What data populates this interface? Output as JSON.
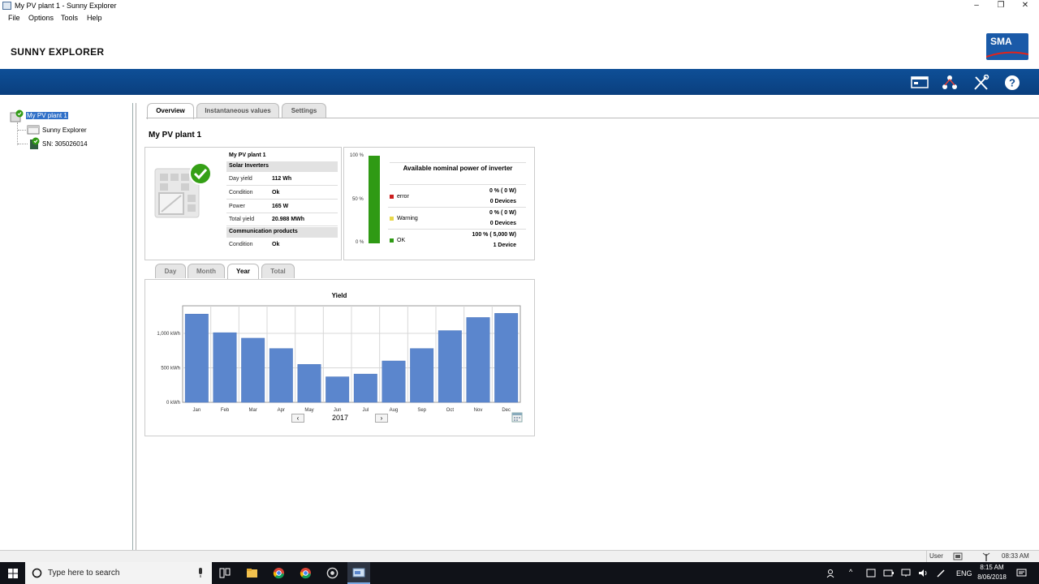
{
  "window": {
    "title": "My PV plant 1 - Sunny Explorer"
  },
  "menu": [
    "File",
    "Options",
    "Tools",
    "Help"
  ],
  "header": {
    "brand": "SUNNY EXPLORER",
    "logo_text": "SMA"
  },
  "toolbar_icons": [
    "console-icon",
    "network-icon",
    "tools-icon",
    "help-icon"
  ],
  "tree": {
    "root": "My PV plant 1",
    "children": [
      "Sunny Explorer",
      "SN: 305026014"
    ]
  },
  "tabs": [
    "Overview",
    "Instantaneous values",
    "Settings"
  ],
  "active_tab": "Overview",
  "page_title": "My PV plant 1",
  "info": {
    "plant_name": "My PV plant 1",
    "section1": "Solar Inverters",
    "rows1": [
      {
        "key": "Day yield",
        "value": "112  Wh"
      },
      {
        "key": "Condition",
        "value": "Ok"
      },
      {
        "key": "Power",
        "value": "165  W"
      },
      {
        "key": "Total yield",
        "value": "20.988  MWh"
      }
    ],
    "section2": "Communication products",
    "rows2": [
      {
        "key": "Condition",
        "value": "Ok"
      }
    ]
  },
  "status": {
    "bar_labels": [
      "100 %",
      "50 %",
      "0 %"
    ],
    "title": "Available nominal power of inverter",
    "bar_level": 1.0,
    "rows": [
      {
        "label": "error",
        "color": "#cc1f1f",
        "pct": "0 %  ( 0 W)",
        "devices": "0 Devices"
      },
      {
        "label": "Warning",
        "color": "#e8d84a",
        "pct": "0 %  ( 0 W)",
        "devices": "0 Devices"
      },
      {
        "label": "OK",
        "color": "#2f9a14",
        "pct": "100 %  ( 5,000 W)",
        "devices": "1 Device"
      }
    ]
  },
  "chart_tabs": [
    "Day",
    "Month",
    "Year",
    "Total"
  ],
  "chart_active_tab": "Year",
  "chart_year": "2017",
  "chart_data": {
    "type": "bar",
    "title": "Yield",
    "categories": [
      "Jan",
      "Feb",
      "Mar",
      "Apr",
      "May",
      "Jun",
      "Jul",
      "Aug",
      "Sep",
      "Oct",
      "Nov",
      "Dec"
    ],
    "values": [
      1280,
      1010,
      930,
      780,
      550,
      370,
      410,
      600,
      780,
      1040,
      1230,
      1290
    ],
    "y_ticks": [
      "0 kWh",
      "500 kWh",
      "1,000 kWh"
    ],
    "ylim": [
      0,
      1400
    ],
    "bar_color": "#5b86cd",
    "grid": true
  },
  "statusbar": {
    "user": "User",
    "time": "08:33 AM"
  },
  "taskbar": {
    "search_placeholder": "Type here to search",
    "lang": "ENG",
    "time": "8:15 AM",
    "date": "8/06/2018"
  }
}
